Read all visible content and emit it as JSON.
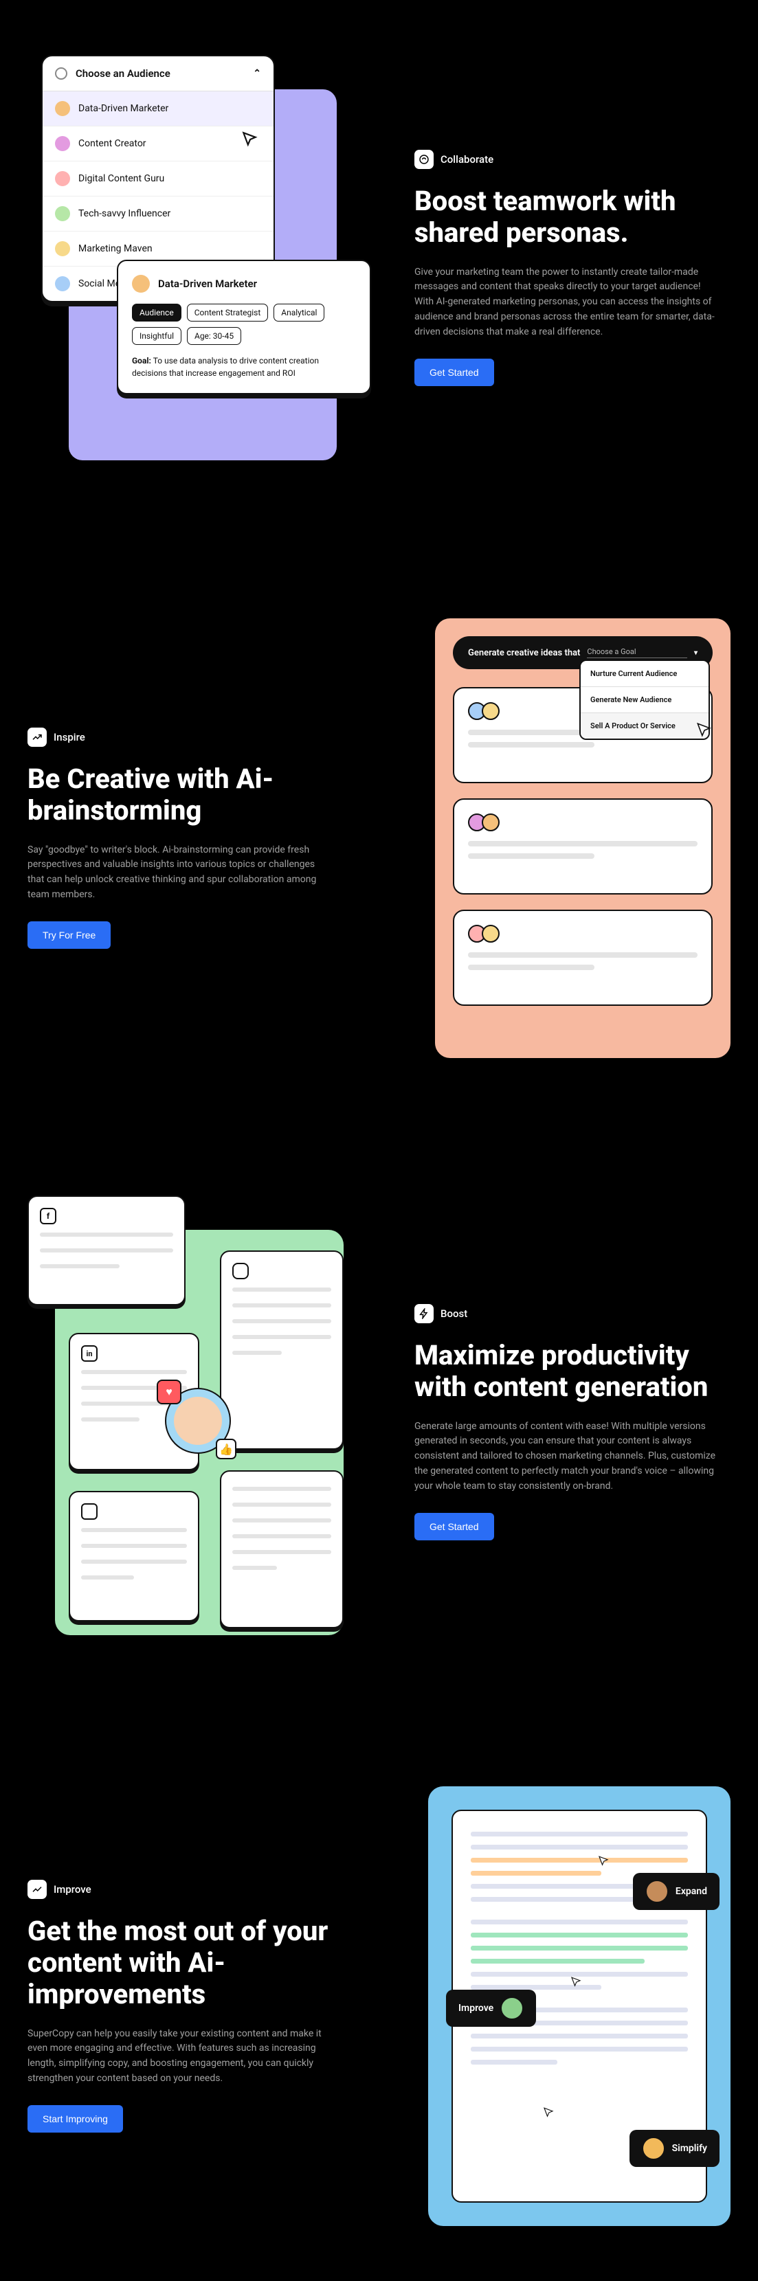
{
  "collaborate": {
    "badge": "Collaborate",
    "heading": "Boost teamwork with shared personas.",
    "desc": "Give your marketing team the power to instantly create tailor-made messages and content that speaks directly to your target audience! With AI-generated marketing personas, you can access the insights of audience and brand personas across the entire team for smarter, data-driven decisions that make a real difference.",
    "cta": "Get Started",
    "dropdown_header": "Choose an Audience",
    "options": [
      "Data-Driven Marketer",
      "Content Creator",
      "Digital Content Guru",
      "Tech-savvy Influencer",
      "Marketing Maven",
      "Social Media Maven"
    ],
    "card_title": "Data-Driven Marketer",
    "card_tags": [
      "Audience",
      "Content Strategist",
      "Analytical",
      "Insightful",
      "Age: 30-45"
    ],
    "card_goal_label": "Goal:",
    "card_goal": "To use data analysis to drive content creation decisions that increase engagement and ROI"
  },
  "inspire": {
    "badge": "Inspire",
    "heading": "Be Creative with Ai-brainstorming",
    "desc": "Say \"goodbye\" to writer's block. Ai-brainstorming can provide fresh perspectives and valuable insights into various topics or challenges that can help unlock creative thinking and spur collaboration among team members.",
    "cta": "Try For Free",
    "prompt_prefix": "Generate creative ideas that",
    "prompt_placeholder": "Choose a Goal",
    "menu": [
      "Nurture Current Audience",
      "Generate New Audience",
      "Sell A Product Or Service"
    ]
  },
  "boost": {
    "badge": "Boost",
    "heading": "Maximize productivity with content generation",
    "desc": "Generate large amounts of content with ease! With multiple versions generated in seconds, you can ensure that your content is always consistent and tailored to chosen marketing channels. Plus, customize the generated content to perfectly match your brand's voice – allowing your whole team to stay consistently on-brand.",
    "cta": "Get Started"
  },
  "improve": {
    "badge": "Improve",
    "heading": "Get the most out of your content with Ai-improvements",
    "desc": "SuperCopy can help you easily take your existing content and make it even more engaging and effective. With features such as increasing length, simplifying copy, and boosting engagement, you can quickly strengthen your content based on your needs.",
    "cta": "Start Improving",
    "pill_expand": "Expand",
    "pill_improve": "Improve",
    "pill_simplify": "Simplify"
  }
}
